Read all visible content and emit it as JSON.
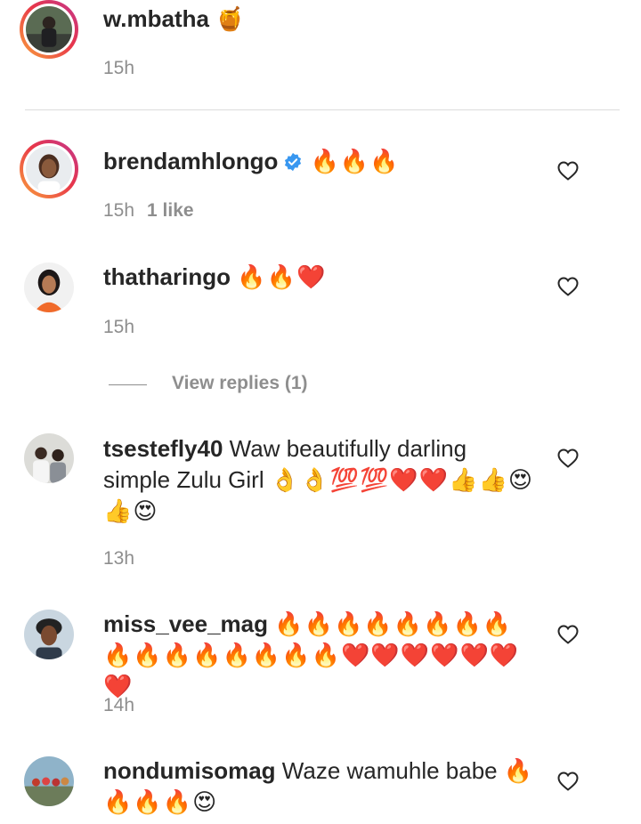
{
  "comments": [
    {
      "username": "w.mbatha",
      "text": "",
      "emoji": "🍯",
      "time": "15h",
      "likes": "",
      "verified": false
    },
    {
      "username": "brendamhlongo",
      "text": "",
      "emoji": "🔥🔥🔥",
      "time": "15h",
      "likes": "1 like",
      "verified": true
    },
    {
      "username": "thatharingo",
      "text": "",
      "emoji": "🔥🔥❤️",
      "time": "15h",
      "likes": "",
      "verified": false
    },
    {
      "username": "tsestefly40",
      "text": "Waw beautifully darling simple Zulu Girl",
      "emoji": "👌👌💯💯❤️❤️👍👍😍👍😍",
      "time": "13h",
      "likes": "",
      "verified": false
    },
    {
      "username": "miss_vee_mag",
      "text": "",
      "emoji": "🔥🔥🔥🔥🔥🔥🔥🔥🔥🔥🔥🔥🔥🔥🔥🔥❤️❤️❤️❤️❤️❤️❤️",
      "time": "14h",
      "likes": "",
      "verified": false
    },
    {
      "username": "nondumisomag",
      "text": "Waze wamuhle babe",
      "emoji": "🔥🔥🔥🔥😍",
      "time": "",
      "likes": "",
      "verified": false
    }
  ],
  "view_replies_label": "View replies (1)",
  "icons": {
    "like": "heart-outline-icon",
    "verified": "verified-badge-icon"
  },
  "colors": {
    "verified_blue": "#3897f0",
    "meta_gray": "#8e8e8e",
    "story_ring_start": "#f9a23b",
    "story_ring_end": "#c2378d"
  }
}
